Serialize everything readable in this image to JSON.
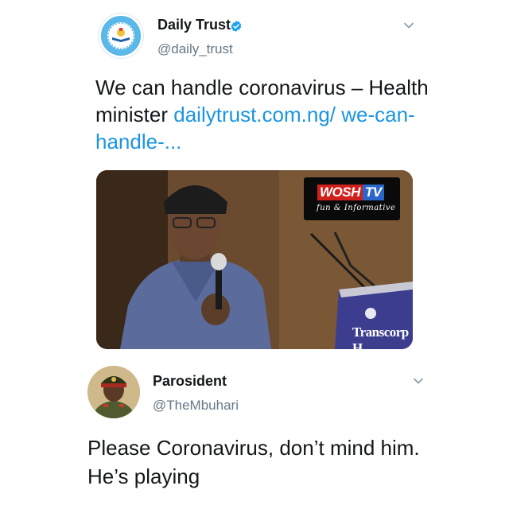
{
  "tweet1": {
    "display_name": "Daily Trust",
    "handle": "@daily_trust",
    "text_plain": "We can handle coronavirus – Health minister ",
    "link_text": "dailytrust.com.ng/ we-can-handle-...",
    "avatar_icon": "daily-trust-logo-icon",
    "verified_icon": "verified-badge-icon",
    "link_color": "#1b95e0",
    "verified_color": "#1da1f2"
  },
  "photo": {
    "watermark_brand_left": "WOSH",
    "watermark_brand_right": "TV",
    "watermark_tagline": "fun & Informative",
    "podium_text": "Transcorp H"
  },
  "tweet2": {
    "display_name": "Parosident",
    "handle": "@TheMbuhari",
    "text": "Please Coronavirus, don’t mind him. He’s playing",
    "avatar_icon": "user-avatar-icon"
  },
  "colors": {
    "text_primary": "#14171a",
    "text_secondary": "#657786"
  }
}
